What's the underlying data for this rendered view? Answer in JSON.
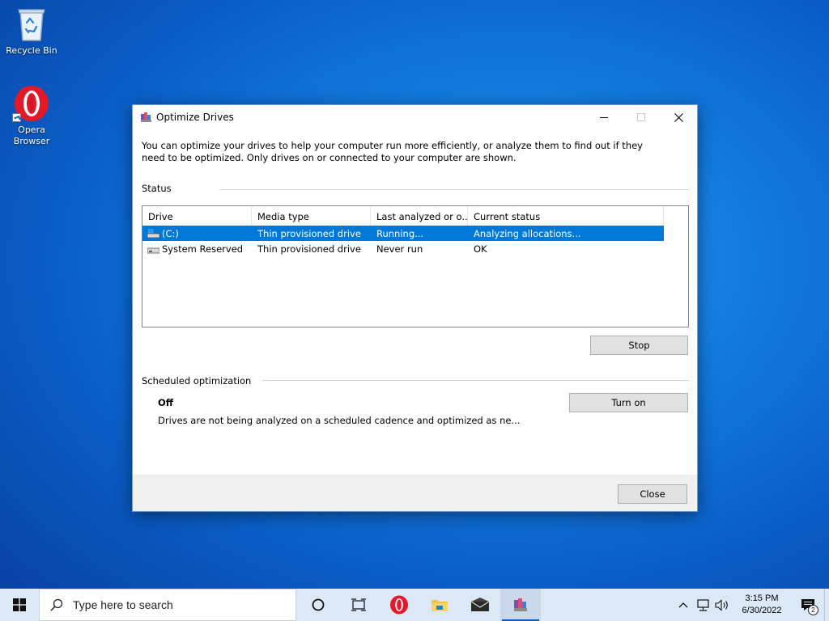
{
  "desktop": {
    "icons": [
      {
        "label": "Recycle Bin"
      },
      {
        "label": "Opera Browser"
      }
    ]
  },
  "window": {
    "title": "Optimize Drives",
    "intro": "You can optimize your drives to help your computer run more efficiently, or analyze them to find out if they need to be optimized. Only drives on or connected to your computer are shown.",
    "status_heading": "Status",
    "columns": [
      "Drive",
      "Media type",
      "Last analyzed or o...",
      "Current status"
    ],
    "drives": [
      {
        "drive": "(C:)",
        "media_type": "Thin provisioned drive",
        "last_analyzed": "Running...",
        "status": "Analyzing allocations...",
        "selected": true
      },
      {
        "drive": "System Reserved",
        "media_type": "Thin provisioned drive",
        "last_analyzed": "Never run",
        "status": "OK",
        "selected": false
      }
    ],
    "stop_label": "Stop",
    "scheduled_heading": "Scheduled optimization",
    "schedule_state": "Off",
    "schedule_desc": "Drives are not being analyzed on a scheduled cadence and optimized as ne...",
    "turn_on_label": "Turn on",
    "close_label": "Close"
  },
  "taskbar": {
    "search_placeholder": "Type here to search",
    "time": "3:15 PM",
    "date": "6/30/2022",
    "notification_count": "2"
  },
  "colors": {
    "selection": "#0078d7",
    "taskbar_bg": "#dce8f5"
  }
}
